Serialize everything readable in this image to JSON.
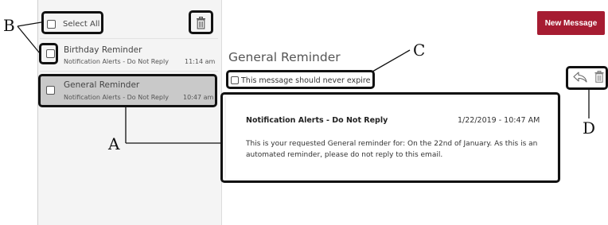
{
  "toolbar": {
    "select_all_label": "Select All"
  },
  "messages": [
    {
      "title": "Birthday Reminder",
      "sender": "Notification Alerts - Do Not Reply",
      "time": "11:14 am"
    },
    {
      "title": "General Reminder",
      "sender": "Notification Alerts - Do Not Reply",
      "time": "10:47 am"
    }
  ],
  "actions": {
    "new_message_label": "New Message"
  },
  "detail": {
    "subject": "General Reminder",
    "expire_label": "This message should never expire",
    "sender": "Notification Alerts - Do Not Reply",
    "date": "1/22/2019 - 10:47 AM",
    "body": "This is your requested General reminder for: On the 22nd of January. As this is an automated reminder, please do not reply to this email."
  },
  "annotations": {
    "a": "A",
    "b": "B",
    "c": "C",
    "d": "D"
  },
  "colors": {
    "accent": "#a61c32",
    "selected_row": "#c9c9c9",
    "pane_bg": "#f4f4f4",
    "annotation": "#111111"
  },
  "icons": [
    "trash-icon",
    "reply-icon"
  ]
}
